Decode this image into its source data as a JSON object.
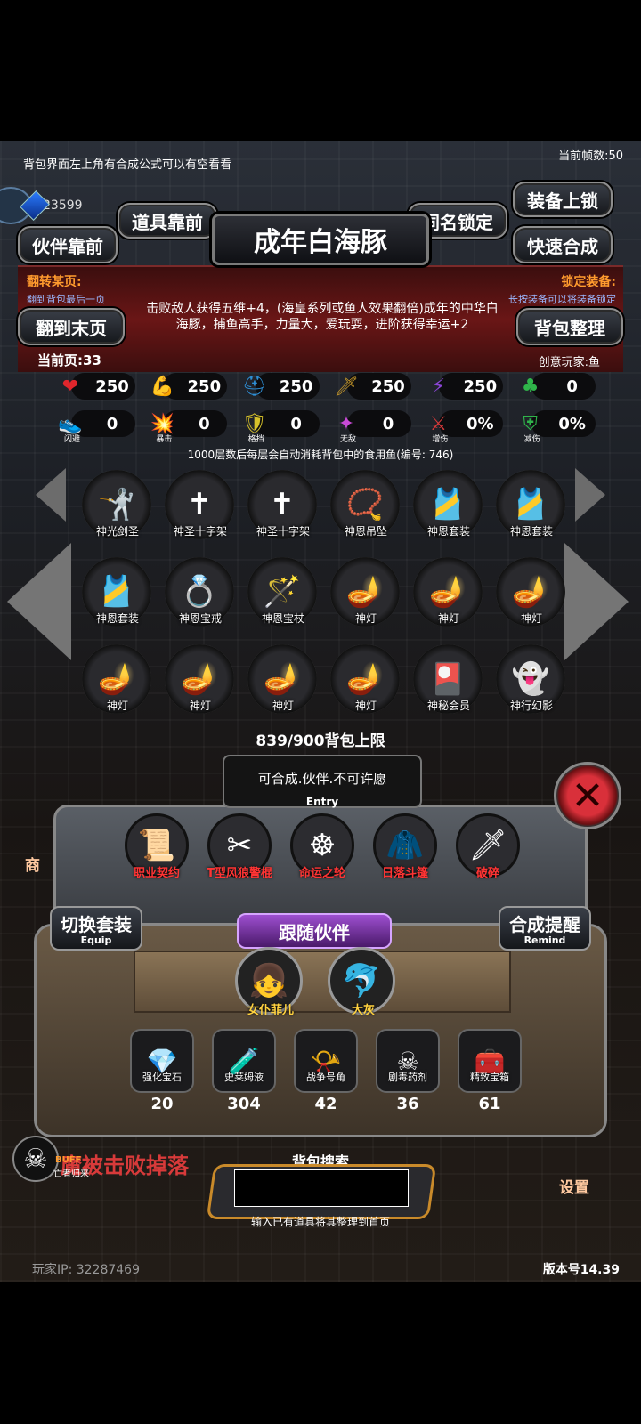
{
  "hint_top": "背包界面左上角有合成公式可以有空看看",
  "fps": "当前帧数:50",
  "gems": "23599",
  "buttons": {
    "partner_front": "伙伴靠前",
    "item_front": "道具靠前",
    "same_name_lock": "同名锁定",
    "equip_lock": "装备上锁",
    "quick_merge": "快速合成",
    "to_last_page": "翻到末页",
    "bag_sort": "背包整理"
  },
  "title": "成年白海豚",
  "flip": {
    "title": "翻转某页:",
    "sub": "翻到背包最后一页"
  },
  "lock": {
    "title": "锁定装备:",
    "sub": "长按装备可以将装备锁定"
  },
  "description": "击败敌人获得五维+4，(海皇系列或鱼人效果翻倍)成年的中华白海豚，捕鱼高手，力量大，爱玩耍，进阶获得幸运+2",
  "current_page": "当前页:33",
  "creator": "创意玩家:鱼",
  "stats_row1": [
    {
      "icon": "heart-icon",
      "glyph": "❤",
      "color": "#e0262c",
      "value": "250"
    },
    {
      "icon": "strength-icon",
      "glyph": "💪",
      "color": "#d9b02a",
      "value": "250"
    },
    {
      "icon": "helmet-icon",
      "glyph": "⛑",
      "color": "#2e8fd6",
      "value": "250"
    },
    {
      "icon": "sword-icon",
      "glyph": "🗡",
      "color": "#c99a2a",
      "value": "250"
    },
    {
      "icon": "magic-icon",
      "glyph": "⚡",
      "color": "#8b45d6",
      "value": "250"
    },
    {
      "icon": "clover-icon",
      "glyph": "♣",
      "color": "#2fb54a",
      "value": "0"
    }
  ],
  "stats_row2": [
    {
      "icon": "dodge-icon",
      "glyph": "👟",
      "color": "#2e8fd6",
      "value": "0",
      "label": "闪避"
    },
    {
      "icon": "crit-icon",
      "glyph": "💥",
      "color": "#c99a2a",
      "value": "0",
      "label": "暴击"
    },
    {
      "icon": "block-icon",
      "glyph": "🛡",
      "color": "#d6c12a",
      "value": "0",
      "label": "格挡"
    },
    {
      "icon": "invincible-icon",
      "glyph": "✦",
      "color": "#c84ad6",
      "value": "0",
      "label": "无敌"
    },
    {
      "icon": "damage-up-icon",
      "glyph": "⚔",
      "color": "#d63a3a",
      "value": "0%",
      "label": "增伤"
    },
    {
      "icon": "damage-down-icon",
      "glyph": "⛨",
      "color": "#2fb54a",
      "value": "0%",
      "label": "减伤"
    }
  ],
  "notice": "1000层数后每层会自动消耗背包中的食用鱼(编号: 746)",
  "items": [
    {
      "name": "神光剑圣",
      "icon": "knight-icon",
      "glyph": "🤺"
    },
    {
      "name": "神圣十字架",
      "icon": "cross-icon",
      "glyph": "✝"
    },
    {
      "name": "神圣十字架",
      "icon": "cross-icon",
      "glyph": "✝"
    },
    {
      "name": "神恩吊坠",
      "icon": "pendant-icon",
      "glyph": "📿"
    },
    {
      "name": "神恩套装",
      "icon": "armor-icon",
      "glyph": "🎽"
    },
    {
      "name": "神恩套装",
      "icon": "armor-icon",
      "glyph": "🎽"
    },
    {
      "name": "神恩套装",
      "icon": "armor-icon",
      "glyph": "🎽"
    },
    {
      "name": "神恩宝戒",
      "icon": "ring-icon",
      "glyph": "💍"
    },
    {
      "name": "神恩宝杖",
      "icon": "staff-icon",
      "glyph": "🪄"
    },
    {
      "name": "神灯",
      "icon": "lamp-icon",
      "glyph": "🪔"
    },
    {
      "name": "神灯",
      "icon": "lamp-icon",
      "glyph": "🪔"
    },
    {
      "name": "神灯",
      "icon": "lamp-icon",
      "glyph": "🪔"
    },
    {
      "name": "神灯",
      "icon": "lamp-icon",
      "glyph": "🪔"
    },
    {
      "name": "神灯",
      "icon": "lamp-icon",
      "glyph": "🪔"
    },
    {
      "name": "神灯",
      "icon": "lamp-icon",
      "glyph": "🪔"
    },
    {
      "name": "神灯",
      "icon": "lamp-icon",
      "glyph": "🪔"
    },
    {
      "name": "神秘会员",
      "icon": "card-icon",
      "glyph": "🎴"
    },
    {
      "name": "神行幻影",
      "icon": "phantom-icon",
      "glyph": "👻"
    }
  ],
  "capacity": "839/900背包上限",
  "entry": {
    "text": "可合成.伙伴.不可许愿",
    "label": "Entry"
  },
  "equips": [
    {
      "name": "职业契约",
      "icon": "scroll-icon",
      "glyph": "📜"
    },
    {
      "name": "T型风狼警棍",
      "icon": "baton-icon",
      "glyph": "✂"
    },
    {
      "name": "命运之轮",
      "icon": "wheel-icon",
      "glyph": "☸"
    },
    {
      "name": "日落斗篷",
      "icon": "cloak-icon",
      "glyph": "🧥"
    },
    {
      "name": "破碎",
      "icon": "broken-sword-icon",
      "glyph": "🗡"
    }
  ],
  "switch_set": {
    "label": "切换套装",
    "sub": "Equip"
  },
  "merge_remind": {
    "label": "合成提醒",
    "sub": "Remind"
  },
  "follow_title": "跟随伙伴",
  "partners": [
    {
      "name": "女仆菲儿",
      "icon": "maid-icon",
      "glyph": "👧"
    },
    {
      "name": "大灰",
      "icon": "dolphin-icon",
      "glyph": "🐬"
    }
  ],
  "materials": [
    {
      "name": "强化宝石",
      "count": "20",
      "icon": "gem-icon",
      "glyph": "💎"
    },
    {
      "name": "史莱姆液",
      "count": "304",
      "icon": "potion-icon",
      "glyph": "🧪"
    },
    {
      "name": "战争号角",
      "count": "42",
      "icon": "horn-icon",
      "glyph": "📯"
    },
    {
      "name": "剧毒药剂",
      "count": "36",
      "icon": "poison-icon",
      "glyph": "☠"
    },
    {
      "name": "精致宝箱",
      "count": "61",
      "icon": "chest-icon",
      "glyph": "🧰"
    }
  ],
  "search": {
    "label": "背包搜索",
    "placeholder": "",
    "hint": "输入已有道具将其整理到首页"
  },
  "buff": {
    "label": "BUFF",
    "sub": "亡者归来"
  },
  "banner": "魔被击败掉落",
  "shop": "商",
  "settings": "设置",
  "player_ip": "玩家IP:  32287469",
  "version": "版本号14.39"
}
